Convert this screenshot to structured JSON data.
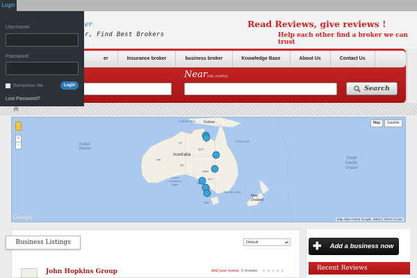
{
  "admin_bar": {
    "login_tab": "Login"
  },
  "login_panel": {
    "username_label": "Username",
    "password_label": "Password",
    "remember_label": "Remember Me",
    "login_button": "Login",
    "lost_password": "Lost Password?"
  },
  "header": {
    "logo_fragment": "er",
    "logo_tagline": "r, Find Best Brokers",
    "tagline1": "Read Reviews, give reviews !",
    "tagline2": "Help each other find a broker we can trust"
  },
  "nav": {
    "items": [
      {
        "label": "er"
      },
      {
        "label": "Insurance broker"
      },
      {
        "label": "business broker"
      },
      {
        "label": "Knowledge Base"
      },
      {
        "label": "About Us"
      },
      {
        "label": "Contact Us"
      }
    ]
  },
  "search": {
    "near_label": "Near",
    "near_hint": "(city, country)",
    "button_label": "Search"
  },
  "map": {
    "type_map": "Map",
    "type_satellite": "Satellite",
    "footer": "Map data ©2015 Google, INEGI  |  Terms of Use",
    "google_logo": "Google",
    "labels": {
      "guinea": "Guinea",
      "arafura": "Arafura Sea",
      "coral": "Coral Sea",
      "indian_ocean": "Indian\nOcean",
      "australia": "Australia",
      "nt": "NT",
      "qld": "QLD",
      "wa": "WA",
      "sa": "SA",
      "nsw": "NSW",
      "act": "ACT",
      "vic": "VIC",
      "tas": "TAS",
      "great_australian_bight": "Great\nAustralian\nBight",
      "tasman": "Tasman Sea",
      "new_zealand": "New\nZealand",
      "south_pacific": "South\nPacific\nOcean"
    }
  },
  "listings": {
    "heading": "Business Listings",
    "sort_selected": "Default",
    "items": [
      {
        "name": "John Hopkins Group",
        "add_review": "Add your review,",
        "reviews": "0 reviews",
        "stars": 0
      }
    ]
  },
  "sidebar": {
    "add_business": "Add a business now",
    "recent_reviews": "Recent Reviews"
  },
  "colors": {
    "brand_red": "#c02020",
    "nav_bg": "#e6e6e6",
    "admin_dark": "#2d3238",
    "map_water": "#a9c9ef"
  }
}
